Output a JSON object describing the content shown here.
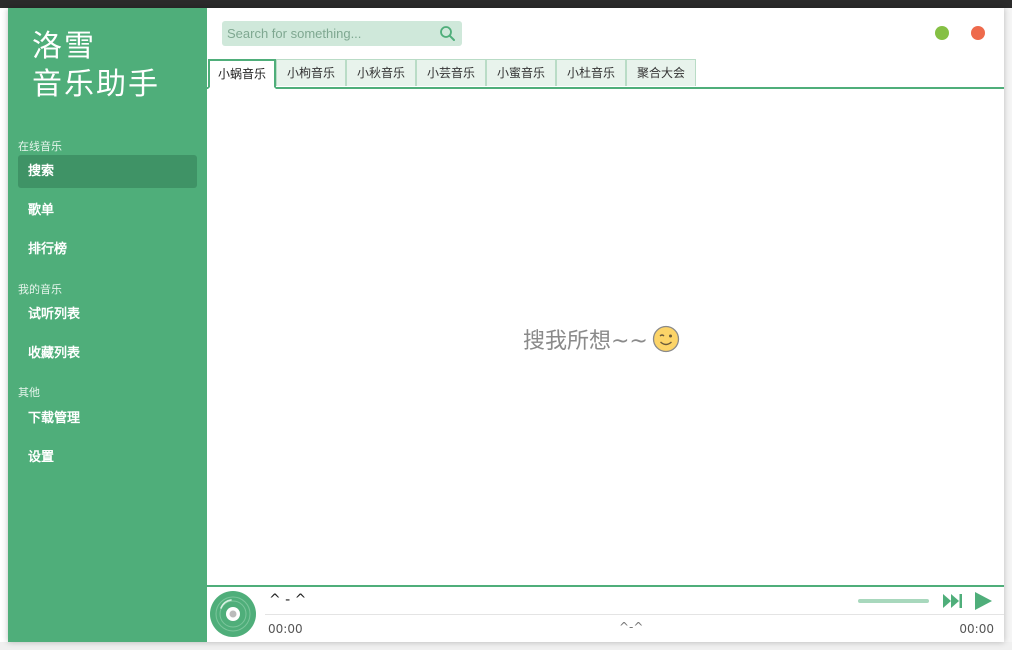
{
  "app": {
    "logo_line1": "洛雪",
    "logo_line2": "音乐助手"
  },
  "colors": {
    "accent": "#4fae7a",
    "accent_dark": "#3f9366",
    "minimize": "#85c044",
    "close": "#ee6a4c"
  },
  "sidebar": {
    "sections": [
      {
        "title": "在线音乐"
      },
      {
        "title": "我的音乐"
      },
      {
        "title": "其他"
      }
    ],
    "items": [
      {
        "label": "搜索",
        "active": true
      },
      {
        "label": "歌单"
      },
      {
        "label": "排行榜"
      },
      {
        "label": "试听列表"
      },
      {
        "label": "收藏列表"
      },
      {
        "label": "下载管理"
      },
      {
        "label": "设置"
      }
    ]
  },
  "search": {
    "placeholder": "Search for something..."
  },
  "tabs": [
    {
      "label": "小蜗音乐",
      "active": true
    },
    {
      "label": "小枸音乐"
    },
    {
      "label": "小秋音乐"
    },
    {
      "label": "小芸音乐"
    },
    {
      "label": "小蜜音乐"
    },
    {
      "label": "小杜音乐"
    },
    {
      "label": "聚合大会"
    }
  ],
  "main": {
    "empty_message": "搜我所想~~"
  },
  "player": {
    "song_title": "^ - ^",
    "time_current": "00:00",
    "time_center": "^-^",
    "time_total": "00:00"
  },
  "icons": {
    "search": "search-icon",
    "emoji": "wink-emoji-icon",
    "disc": "music-disc-icon",
    "next": "next-track-icon",
    "play": "play-icon"
  }
}
